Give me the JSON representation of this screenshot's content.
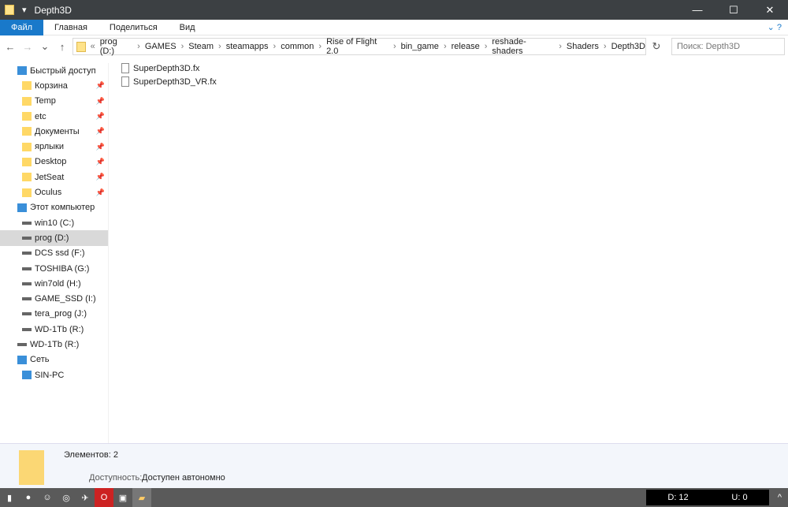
{
  "window": {
    "title": "Depth3D"
  },
  "ribbon": {
    "tabs": [
      "Файл",
      "Главная",
      "Поделиться",
      "Вид"
    ]
  },
  "address": {
    "prefix": "«",
    "path": [
      "prog (D:)",
      "GAMES",
      "Steam",
      "steamapps",
      "common",
      "Rise of Flight 2.0",
      "bin_game",
      "release",
      "reshade-shaders",
      "Shaders",
      "Depth3D"
    ]
  },
  "search": {
    "placeholder": "Поиск: Depth3D"
  },
  "sidebar": {
    "quick": "Быстрый доступ",
    "quick_items": [
      "Корзина",
      "Temp",
      "etc",
      "Документы",
      "ярлыки",
      "Desktop",
      "JetSeat",
      "Oculus"
    ],
    "pc": "Этот компьютер",
    "drives": [
      "win10 (C:)",
      "prog (D:)",
      "DCS ssd (F:)",
      "TOSHIBA (G:)",
      "win7old (H:)",
      "GAME_SSD (I:)",
      "tera_prog (J:)",
      "WD-1Tb (R:)"
    ],
    "extra": "WD-1Tb (R:)",
    "net": "Сеть",
    "net_items": [
      "SIN-PC"
    ]
  },
  "files": [
    "SuperDepth3D.fx",
    "SuperDepth3D_VR.fx"
  ],
  "details": {
    "count": "Элементов: 2",
    "avail_label": "Доступность:",
    "avail_value": "Доступен автономно"
  },
  "taskbar": {
    "down": "D: 12",
    "up": "U: 0"
  }
}
